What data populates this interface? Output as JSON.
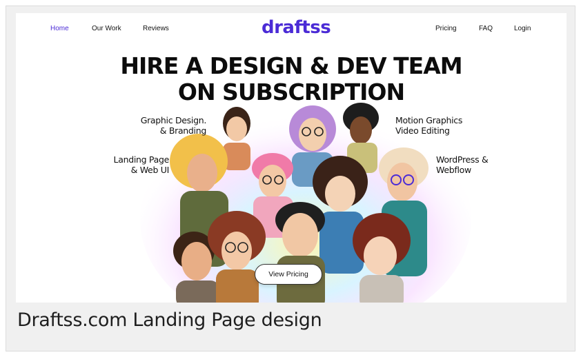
{
  "nav": {
    "left_links": [
      "Home",
      "Our Work",
      "Reviews"
    ],
    "right_links": [
      "Pricing",
      "FAQ",
      "Login"
    ],
    "active": "Home",
    "logo": "draftss"
  },
  "hero": {
    "headline_line1": "HIRE A DESIGN & DEV TEAM",
    "headline_line2": "ON SUBSCRIPTION",
    "services": {
      "graphic": [
        "Graphic Design.",
        "& Branding"
      ],
      "landing": [
        "Landing Page",
        "& Web UI"
      ],
      "motion": [
        "Motion Graphics",
        "Video Editing"
      ],
      "wordpress": [
        "WordPress &",
        "Webflow"
      ]
    },
    "cta_label": "View Pricing"
  },
  "caption": "Draftss.com Landing Page design",
  "colors": {
    "brand": "#4b2bd6",
    "text": "#111111",
    "card_bg": "#f0f0f0"
  },
  "icons": [
    "team-illustration"
  ]
}
